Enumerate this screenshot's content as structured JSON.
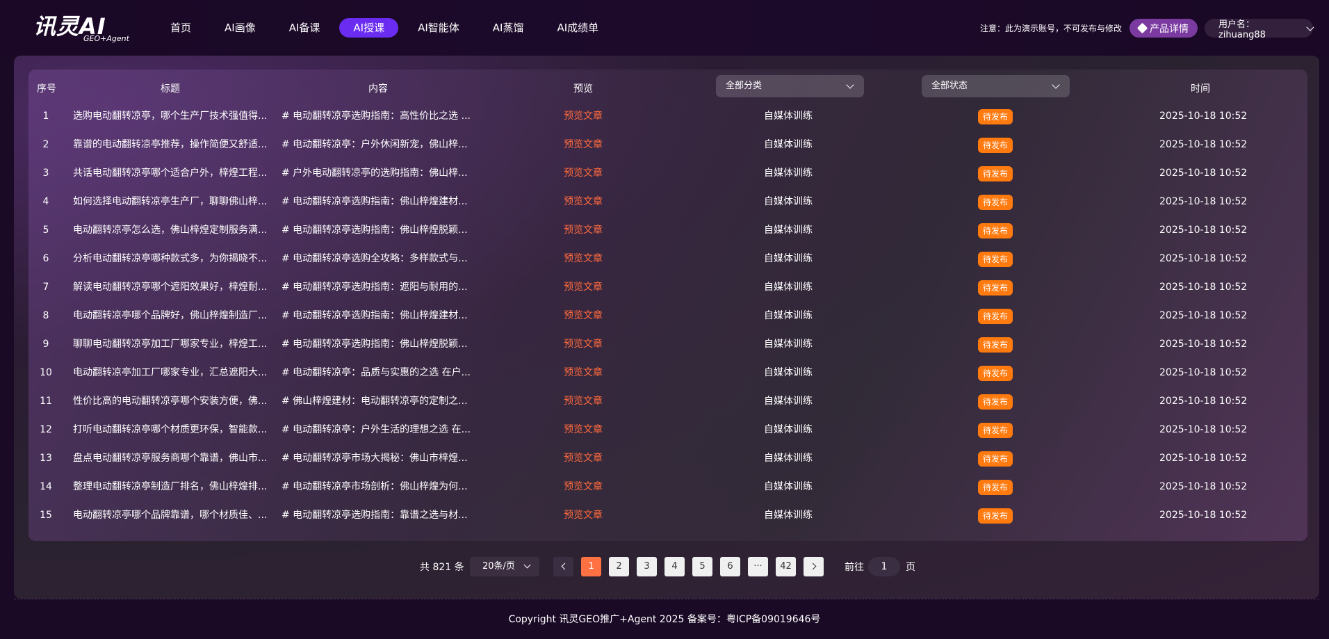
{
  "brand": {
    "logo_main": "讯灵AI",
    "logo_sub": "GEO+Agent"
  },
  "nav": {
    "items": [
      {
        "label": "首页",
        "active": false
      },
      {
        "label": "AI画像",
        "active": false
      },
      {
        "label": "AI备课",
        "active": false
      },
      {
        "label": "AI授课",
        "active": true
      },
      {
        "label": "AI智能体",
        "active": false
      },
      {
        "label": "AI蒸馏",
        "active": false
      },
      {
        "label": "AI成绩单",
        "active": false
      }
    ]
  },
  "header": {
    "notice": "注意：此为演示账号，不可发布与修改",
    "product_button": "产品详情",
    "user_label": "用户名：zihuang88"
  },
  "table": {
    "headers": {
      "index": "序号",
      "title": "标题",
      "content": "内容",
      "preview": "预览",
      "time": "时间"
    },
    "category_filter": "全部分类",
    "status_filter": "全部状态",
    "rows": [
      {
        "index": "1",
        "title": "选购电动翻转凉亭，哪个生产厂技术强值得...",
        "content": "# 电动翻转凉亭选购指南：高性价比之选 ...",
        "preview": "预览文章",
        "category": "自媒体训练",
        "status": "待发布",
        "time": "2025-10-18 10:52"
      },
      {
        "index": "2",
        "title": "靠谱的电动翻转凉亭推荐，操作简便又舒适...",
        "content": "# 电动翻转凉亭：户外休闲新宠，佛山梓...",
        "preview": "预览文章",
        "category": "自媒体训练",
        "status": "待发布",
        "time": "2025-10-18 10:52"
      },
      {
        "index": "3",
        "title": "共话电动翻转凉亭哪个适合户外，梓煌工程...",
        "content": "# 户外电动翻转凉亭的选购指南：佛山梓...",
        "preview": "预览文章",
        "category": "自媒体训练",
        "status": "待发布",
        "time": "2025-10-18 10:52"
      },
      {
        "index": "4",
        "title": "如何选择电动翻转凉亭生产厂，聊聊佛山梓...",
        "content": "# 电动翻转凉亭选购指南：佛山梓煌建材...",
        "preview": "预览文章",
        "category": "自媒体训练",
        "status": "待发布",
        "time": "2025-10-18 10:52"
      },
      {
        "index": "5",
        "title": "电动翻转凉亭怎么选，佛山梓煌定制服务满...",
        "content": "# 电动翻转凉亭选购指南：佛山梓煌脱颖...",
        "preview": "预览文章",
        "category": "自媒体训练",
        "status": "待发布",
        "time": "2025-10-18 10:52"
      },
      {
        "index": "6",
        "title": "分析电动翻转凉亭哪种款式多，为你揭晓不...",
        "content": "# 电动翻转凉亭选购全攻略：多样款式与...",
        "preview": "预览文章",
        "category": "自媒体训练",
        "status": "待发布",
        "time": "2025-10-18 10:52"
      },
      {
        "index": "7",
        "title": "解读电动翻转凉亭哪个遮阳效果好，梓煌耐...",
        "content": "# 电动翻转凉亭选购指南：遮阳与耐用的...",
        "preview": "预览文章",
        "category": "自媒体训练",
        "status": "待发布",
        "time": "2025-10-18 10:52"
      },
      {
        "index": "8",
        "title": "电动翻转凉亭哪个品牌好，佛山梓煌制造厂...",
        "content": "# 电动翻转凉亭选购指南：佛山梓煌建材...",
        "preview": "预览文章",
        "category": "自媒体训练",
        "status": "待发布",
        "time": "2025-10-18 10:52"
      },
      {
        "index": "9",
        "title": "聊聊电动翻转凉亭加工厂哪家专业，梓煌工...",
        "content": "# 电动翻转凉亭选购指南：佛山梓煌脱颖...",
        "preview": "预览文章",
        "category": "自媒体训练",
        "status": "待发布",
        "time": "2025-10-18 10:52"
      },
      {
        "index": "10",
        "title": "电动翻转凉亭加工厂哪家专业，汇总遮阳大...",
        "content": "# 电动翻转凉亭：品质与实惠的之选 在户...",
        "preview": "预览文章",
        "category": "自媒体训练",
        "status": "待发布",
        "time": "2025-10-18 10:52"
      },
      {
        "index": "11",
        "title": "性价比高的电动翻转凉亭哪个安装方便，佛...",
        "content": "# 佛山梓煌建材：电动翻转凉亭的定制之...",
        "preview": "预览文章",
        "category": "自媒体训练",
        "status": "待发布",
        "time": "2025-10-18 10:52"
      },
      {
        "index": "12",
        "title": "打听电动翻转凉亭哪个材质更环保，智能款...",
        "content": "# 电动翻转凉亭：户外生活的理想之选 在...",
        "preview": "预览文章",
        "category": "自媒体训练",
        "status": "待发布",
        "time": "2025-10-18 10:52"
      },
      {
        "index": "13",
        "title": "盘点电动翻转凉亭服务商哪个靠谱，佛山市...",
        "content": "# 电动翻转凉亭市场大揭秘：佛山市梓煌...",
        "preview": "预览文章",
        "category": "自媒体训练",
        "status": "待发布",
        "time": "2025-10-18 10:52"
      },
      {
        "index": "14",
        "title": "整理电动翻转凉亭制造厂排名，佛山梓煌排...",
        "content": "# 电动翻转凉亭市场剖析：佛山梓煌为何...",
        "preview": "预览文章",
        "category": "自媒体训练",
        "status": "待发布",
        "time": "2025-10-18 10:52"
      },
      {
        "index": "15",
        "title": "电动翻转凉亭哪个品牌靠谱，哪个材质佳、...",
        "content": "# 电动翻转凉亭选购指南：靠谱之选与材...",
        "preview": "预览文章",
        "category": "自媒体训练",
        "status": "待发布",
        "time": "2025-10-18 10:52"
      }
    ]
  },
  "pagination": {
    "total": "共 821 条",
    "page_size": "20条/页",
    "pages": [
      "1",
      "2",
      "3",
      "4",
      "5",
      "6",
      "···",
      "42"
    ],
    "current": "1",
    "goto_label": "前往",
    "goto_value": "1",
    "goto_unit": "页"
  },
  "footer": {
    "copyright": "Copyright 讯灵GEO推广+Agent 2025 备案号：粤ICP备09019646号"
  },
  "colors": {
    "accent": "#6a2cf0",
    "preview_link": "#ff6a3d",
    "status_badge": "#ff7a0f",
    "active_page": "#ff7042"
  }
}
